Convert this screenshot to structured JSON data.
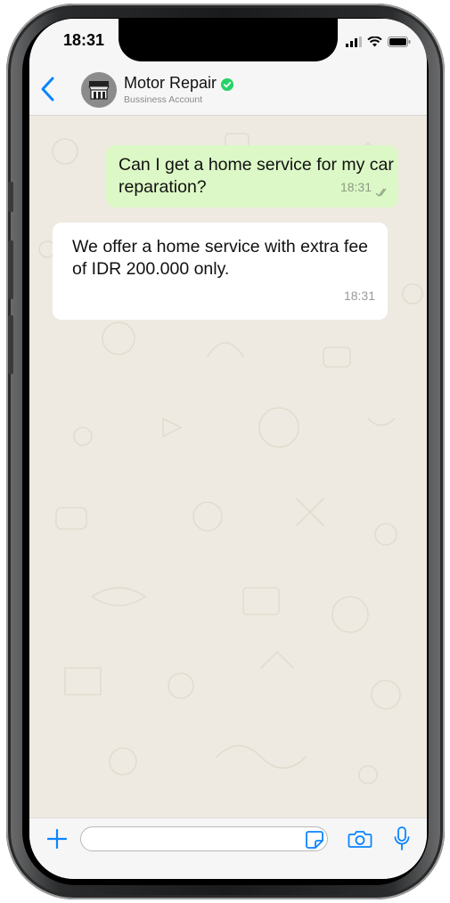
{
  "status_bar": {
    "time": "18:31"
  },
  "chat_header": {
    "contact_name": "Motor Repair",
    "subtitle": "Bussiness Account"
  },
  "messages": [
    {
      "direction": "outgoing",
      "text": "Can I get a home service for my car reparation?",
      "time": "18:31",
      "status": "read"
    },
    {
      "direction": "incoming",
      "text": "We offer a home service with extra fee of IDR 200.000 only.",
      "time": "18:31"
    }
  ],
  "input_bar": {
    "placeholder": "",
    "value": ""
  },
  "colors": {
    "outgoing_bubble": "#dcf8c6",
    "incoming_bubble": "#ffffff",
    "accent_blue": "#0a84ff",
    "verified_green": "#25d366",
    "chat_background": "#efeae1"
  },
  "icons": [
    "back-chevron-icon",
    "shop-icon",
    "verified-icon",
    "double-check-icon",
    "plus-icon",
    "sticker-icon",
    "camera-icon",
    "microphone-icon",
    "signal-icon",
    "wifi-icon",
    "battery-icon"
  ]
}
